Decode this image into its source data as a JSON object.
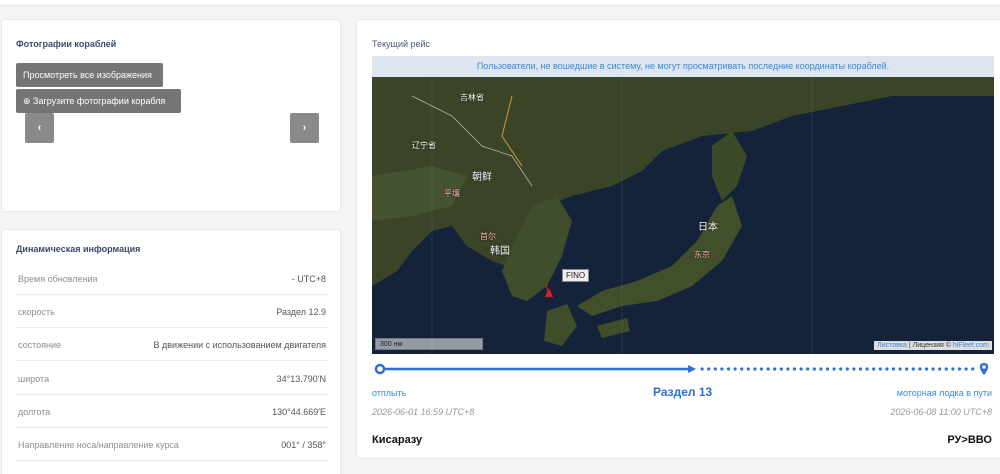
{
  "photos": {
    "title": "Фотографии кораблей",
    "view_all_label": "Просмотреть все изображения",
    "upload_label": "⊕ Загрузите фотографии корабля",
    "prev_label": "‹",
    "next_label": "›"
  },
  "dynamic": {
    "title": "Динамическая информация",
    "rows": [
      {
        "label": "Время обновления",
        "value": "- UTC+8"
      },
      {
        "label": "скорость",
        "value": "Раздел 12.9"
      },
      {
        "label": "состояние",
        "value": "В движении с использованием двигателя"
      },
      {
        "label": "широта",
        "value": "34°13.790'N"
      },
      {
        "label": "долгота",
        "value": "130°44.669'E"
      },
      {
        "label": "Направление носа/направление курса",
        "value": "001° / 358°"
      }
    ]
  },
  "voyage": {
    "title": "Текущий рейс",
    "map": {
      "banner": "Пользователи, не вошедшие в систему, не могут просматривать последние координаты кораблей.",
      "ship_name": "FINO",
      "scale": "300 нм",
      "attribution_link1": "Листовка",
      "attribution_sep": " | Лицензия © ",
      "attribution_link2": "hiFleet.com",
      "labels": {
        "jilin": "吉林省",
        "liaoning": "辽宁省",
        "dprk": "朝鲜",
        "pyongyang": "平壤",
        "seoul": "首尔",
        "korea": "韩国",
        "japan": "日本",
        "tokyo": "东京"
      }
    },
    "departure_label": "отплыть",
    "section_label": "Раздел 13",
    "status_label": "моторная лодка в пути",
    "departure_time": "2026-06-01 16:59 UTC+8",
    "eta_time": "2026-06-08 11:00 UTC+8",
    "departure_port": "Кисаразу",
    "destination_port": "РУ>ВВО",
    "progress": 0.52
  },
  "colors": {
    "accent": "#2f6fcf",
    "link": "#3c88d8",
    "button": "#757575",
    "ship_marker": "#e02020"
  }
}
